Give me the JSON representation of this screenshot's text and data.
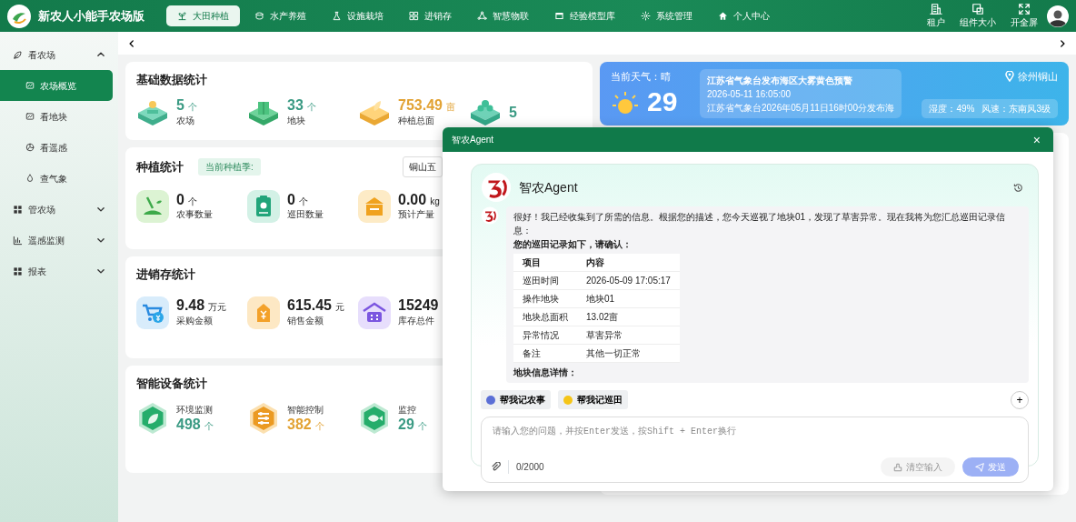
{
  "header": {
    "title": "新农人小能手农场版",
    "nav": [
      {
        "label": "大田种植",
        "selected": true
      },
      {
        "label": "水产养殖",
        "selected": false
      },
      {
        "label": "设施栽培",
        "selected": false
      },
      {
        "label": "进销存",
        "selected": false
      },
      {
        "label": "智慧物联",
        "selected": false
      },
      {
        "label": "经验模型库",
        "selected": false
      },
      {
        "label": "系统管理",
        "selected": false
      },
      {
        "label": "个人中心",
        "selected": false
      }
    ],
    "tools": [
      {
        "label": "租户"
      },
      {
        "label": "组件大小"
      },
      {
        "label": "开全屏"
      }
    ]
  },
  "sidebar": {
    "items": [
      {
        "label": "看农场",
        "expanded": true,
        "children": [
          {
            "label": "农场概览",
            "selected": true
          },
          {
            "label": "看地块",
            "selected": false
          },
          {
            "label": "看遥感",
            "selected": false
          },
          {
            "label": "查气象",
            "selected": false
          }
        ]
      },
      {
        "label": "管农场",
        "expanded": false
      },
      {
        "label": "遥感监测",
        "expanded": false
      },
      {
        "label": "报表",
        "expanded": false
      }
    ]
  },
  "sections": [
    {
      "title": "基础数据统计",
      "kind": "metric",
      "stats": [
        {
          "kind": "farm",
          "value": "5",
          "unit": "个",
          "label": "农场",
          "color": "#3a9a83"
        },
        {
          "kind": "plot",
          "value": "33",
          "unit": "个",
          "label": "地块",
          "color": "#3a9a83"
        },
        {
          "kind": "area",
          "value": "753.49",
          "unit": "亩",
          "label": "种植总面",
          "color": "#e2a233"
        },
        {
          "kind": "tree",
          "value": "5",
          "color": "#3a9a83"
        }
      ]
    },
    {
      "title": "种植统计",
      "kind": "metric",
      "tag": "当前种植季:",
      "select": "铜山五",
      "stats": [
        {
          "kind": "farmwork",
          "value": "0",
          "unit": "个",
          "label": "农事数量"
        },
        {
          "kind": "patrol",
          "value": "0",
          "unit": "个",
          "label": "巡田数量"
        },
        {
          "kind": "yield",
          "value": "0.00",
          "unit": "kg",
          "label": "预计产量"
        }
      ]
    },
    {
      "title": "进销存统计",
      "kind": "metric",
      "stats": [
        {
          "kind": "cart",
          "value": "9.48",
          "unit": "万元",
          "label": "采购金额"
        },
        {
          "kind": "sale",
          "value": "615.45",
          "unit": "元",
          "label": "销售金额"
        },
        {
          "kind": "stock",
          "value": "15249",
          "label": "库存总件"
        }
      ]
    },
    {
      "title": "智能设备统计",
      "kind": "device",
      "stats": [
        {
          "kind": "env",
          "value": "498",
          "unit": "个",
          "label": "环境监测",
          "color": "#3a9a83"
        },
        {
          "kind": "control",
          "value": "382",
          "unit": "个",
          "label": "智能控制",
          "color": "#e2a233"
        },
        {
          "kind": "camera",
          "value": "29",
          "unit": "个",
          "label": "监控",
          "color": "#3a9a83"
        }
      ]
    }
  ],
  "weather": {
    "label": "当前天气：晴",
    "temperature": "29",
    "alert_title": "江苏省气象台发布海区大雾黄色预警",
    "alert_time": "2026-05-11 16:05:00",
    "alert_text": "江苏省气象台2026年05月11日16时00分发布海",
    "location": "徐州铜山",
    "humidity": "湿度：49%",
    "wind": "风速：东南风3级"
  },
  "agent": {
    "title": "智农Agent",
    "close": "×",
    "name": "智农Agent",
    "message": {
      "text": "很好！我已经收集到了所需的信息。根据您的描述，您今天巡视了地块01，发现了草害异常。现在我将为您汇总巡田记录信息：",
      "lead": "您的巡田记录如下，请确认：",
      "table": {
        "columns": [
          "项目",
          "内容"
        ],
        "rows": [
          [
            "巡田时间",
            "2026-05-09 17:05:17"
          ],
          [
            "操作地块",
            "地块01"
          ],
          [
            "地块总面积",
            "13.02亩"
          ],
          [
            "异常情况",
            "草害异常"
          ],
          [
            "备注",
            "其他一切正常"
          ]
        ]
      },
      "tail": "地块信息详情："
    },
    "chips": [
      {
        "label": "帮我记农事",
        "color": "#5b6fd6"
      },
      {
        "label": "帮我记巡田",
        "color": "#f5c518"
      }
    ],
    "add": "+",
    "input": {
      "placeholder": "请输入您的问题，并按Enter发送，按Shift + Enter换行",
      "counter": "0/2000"
    },
    "buttons": [
      {
        "label": "清空输入",
        "kind": "clear",
        "disabled": true
      },
      {
        "label": "发送",
        "kind": "send",
        "disabled": true
      }
    ]
  }
}
